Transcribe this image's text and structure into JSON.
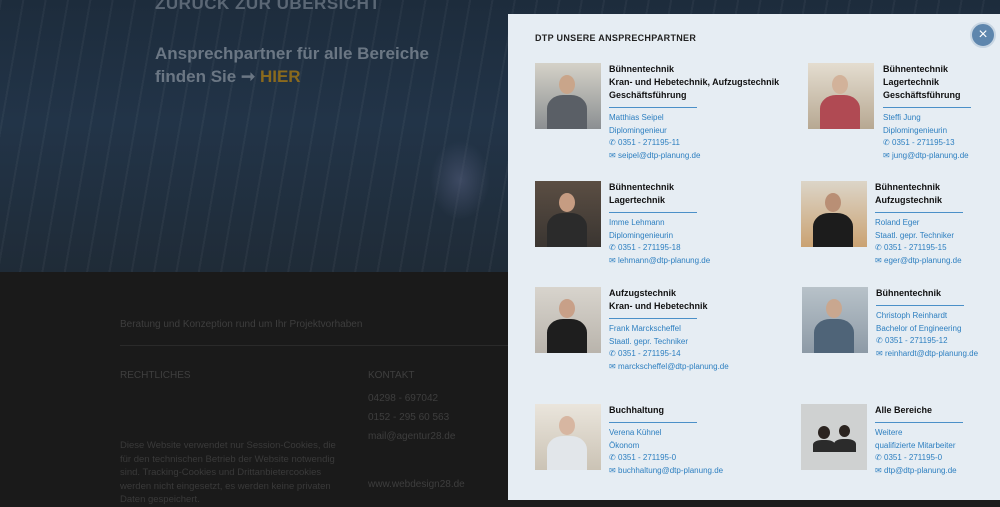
{
  "background": {
    "back_link": "ZURÜCK ZUR ÜBERSICHT",
    "headline_line1": "Ansprechpartner für alle Bereiche",
    "headline_line2_prefix": "finden Sie",
    "headline_arrow": "➞",
    "headline_link": "HIER",
    "footer": {
      "tagline": "Beratung und Konzeption rund um Ihr Projektvorhaben",
      "legal_heading": "RECHTLICHES",
      "contact_heading": "KONTAKT",
      "phone1": "04298 - 697042",
      "phone2": "0152 - 295 60 563",
      "email": "mail@agentur28.de",
      "website": "www.webdesign28.de",
      "cookie_text": "Diese Website verwendet nur Session-Cookies, die für den technischen Betrieb der Website notwendig sind. Tracking-Cookies und Drittanbietercookies werden nicht eingesetzt, es werden keine privaten Daten gespeichert."
    }
  },
  "panel": {
    "title": "DTP UNSERE ANSPRECHPARTNER",
    "close_label": "×",
    "contacts": [
      {
        "role": [
          "Bühnentechnik",
          "Kran- und Hebetechnik, Aufzugstechnik",
          "Geschäftsführung"
        ],
        "name": "Matthias Seipel",
        "title": "Diplomingenieur",
        "phone": "0351 - 271195-11",
        "email": "seipel@dtp-planung.de"
      },
      {
        "role": [
          "Bühnentechnik",
          "Lagertechnik",
          "Geschäftsführung"
        ],
        "name": "Steffi Jung",
        "title": "Diplomingenieurin",
        "phone": "0351 - 271195-13",
        "email": "jung@dtp-planung.de"
      },
      {
        "role": [
          "Bühnentechnik",
          "Lagertechnik"
        ],
        "name": "Imme Lehmann",
        "title": "Diplomingenieurin",
        "phone": "0351 - 271195-18",
        "email": "lehmann@dtp-planung.de"
      },
      {
        "role": [
          "Bühnentechnik",
          "Aufzugstechnik"
        ],
        "name": "Roland Eger",
        "title": "Staatl. gepr. Techniker",
        "phone": "0351 - 271195-15",
        "email": "eger@dtp-planung.de"
      },
      {
        "role": [
          "Aufzugstechnik",
          "Kran- und Hebetechnik"
        ],
        "name": "Frank Marckscheffel",
        "title": "Staatl. gepr. Techniker",
        "phone": "0351 - 271195-14",
        "email": "marckscheffel@dtp-planung.de"
      },
      {
        "role": [
          "Bühnentechnik"
        ],
        "name": "Christoph Reinhardt",
        "title": "Bachelor of Engineering",
        "phone": "0351 - 271195-12",
        "email": "reinhardt@dtp-planung.de"
      },
      {
        "role": [
          "Buchhaltung"
        ],
        "name": "Verena Kühnel",
        "title": "Ökonom",
        "phone": "0351 - 271195-0",
        "email": "buchhaltung@dtp-planung.de"
      },
      {
        "role": [
          "Alle Bereiche"
        ],
        "name": "Weitere",
        "title": "qualifizierte Mitarbeiter",
        "phone": "0351 - 271195-0",
        "email": "dtp@dtp-planung.de"
      }
    ]
  },
  "icons": {
    "phone": "phone-icon",
    "mail": "mail-icon",
    "close": "close-icon"
  },
  "colors": {
    "accent": "#2d7fc0",
    "panel_bg": "#e6edf3",
    "close_btn": "#5e86ad",
    "separator": "#4b90c8"
  }
}
